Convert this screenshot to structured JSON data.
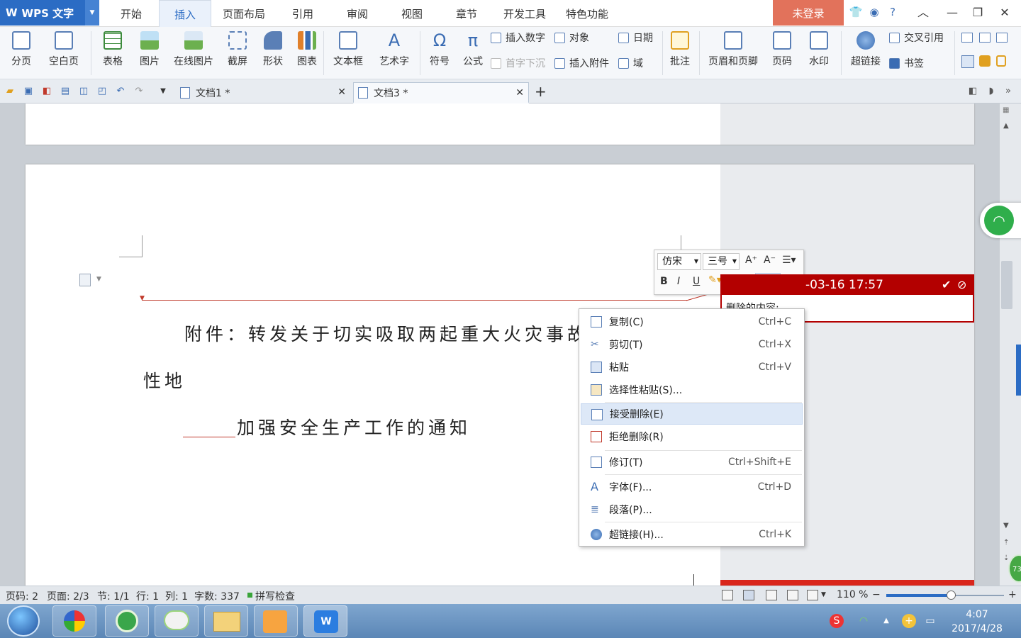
{
  "app": {
    "name": "WPS 文字"
  },
  "menu_tabs": [
    "开始",
    "插入",
    "页面布局",
    "引用",
    "审阅",
    "视图",
    "章节",
    "开发工具",
    "特色功能"
  ],
  "active_tab": "插入",
  "login_label": "未登录",
  "ribbon": {
    "big": [
      "分页",
      "空白页",
      "表格",
      "图片",
      "在线图片",
      "截屏",
      "形状",
      "图表",
      "文本框",
      "艺术字",
      "符号",
      "公式",
      "批注",
      "页眉和页脚",
      "页码",
      "水印",
      "超链接"
    ],
    "small": {
      "insert_number": "插入数字",
      "object": "对象",
      "date": "日期",
      "drop_cap": "首字下沉",
      "insert_attachment": "插入附件",
      "field": "域",
      "cross_ref": "交叉引用",
      "bookmark": "书签"
    }
  },
  "doc_tabs": [
    {
      "label": "文档1 *"
    },
    {
      "label": "文档3 *"
    }
  ],
  "document": {
    "line1": "附件：转发关于切实吸取两起重大火灾事故教",
    "line2": "性地",
    "line3": "加强安全生产工作的通知"
  },
  "mini_toolbar": {
    "font": "仿宋",
    "size": "三号",
    "bold": "B",
    "italic": "I",
    "underline": "U",
    "grow": "A⁺",
    "shrink": "A⁻"
  },
  "balloon": {
    "timestamp": "-03-16 17:57",
    "text": "删除的内容:"
  },
  "context_menu": [
    {
      "label": "复制(C)",
      "shortcut": "Ctrl+C",
      "icon": "copy-icon"
    },
    {
      "label": "剪切(T)",
      "shortcut": "Ctrl+X",
      "icon": "scissors-icon"
    },
    {
      "label": "粘贴",
      "shortcut": "Ctrl+V",
      "icon": "paste-icon"
    },
    {
      "label": "选择性粘贴(S)...",
      "shortcut": "",
      "icon": "paste-special-icon"
    },
    {
      "label": "接受删除(E)",
      "shortcut": "",
      "icon": "accept-icon"
    },
    {
      "label": "拒绝删除(R)",
      "shortcut": "",
      "icon": "reject-icon"
    },
    {
      "label": "修订(T)",
      "shortcut": "Ctrl+Shift+E",
      "icon": "track-changes-icon"
    },
    {
      "label": "字体(F)...",
      "shortcut": "Ctrl+D",
      "icon": "font-icon"
    },
    {
      "label": "段落(P)...",
      "shortcut": "",
      "icon": "paragraph-icon"
    },
    {
      "label": "超链接(H)...",
      "shortcut": "Ctrl+K",
      "icon": "hyperlink-icon"
    }
  ],
  "statusbar": {
    "page_no": "页码: 2",
    "pages": "页面: 2/3",
    "section": "节: 1/1",
    "row": "行: 1",
    "col": "列: 1",
    "word_count": "字数: 337",
    "spell_check": "拼写检查",
    "zoom": "110 %"
  },
  "zoom_level": 0.55,
  "taskbar": {
    "time": "4:07",
    "date": "2017/4/28",
    "float_badge": "73"
  },
  "colors": {
    "accent": "#2b6cc4",
    "login": "#e2725b",
    "revision": "#b30000",
    "menu_hover": "#dde8f7"
  }
}
